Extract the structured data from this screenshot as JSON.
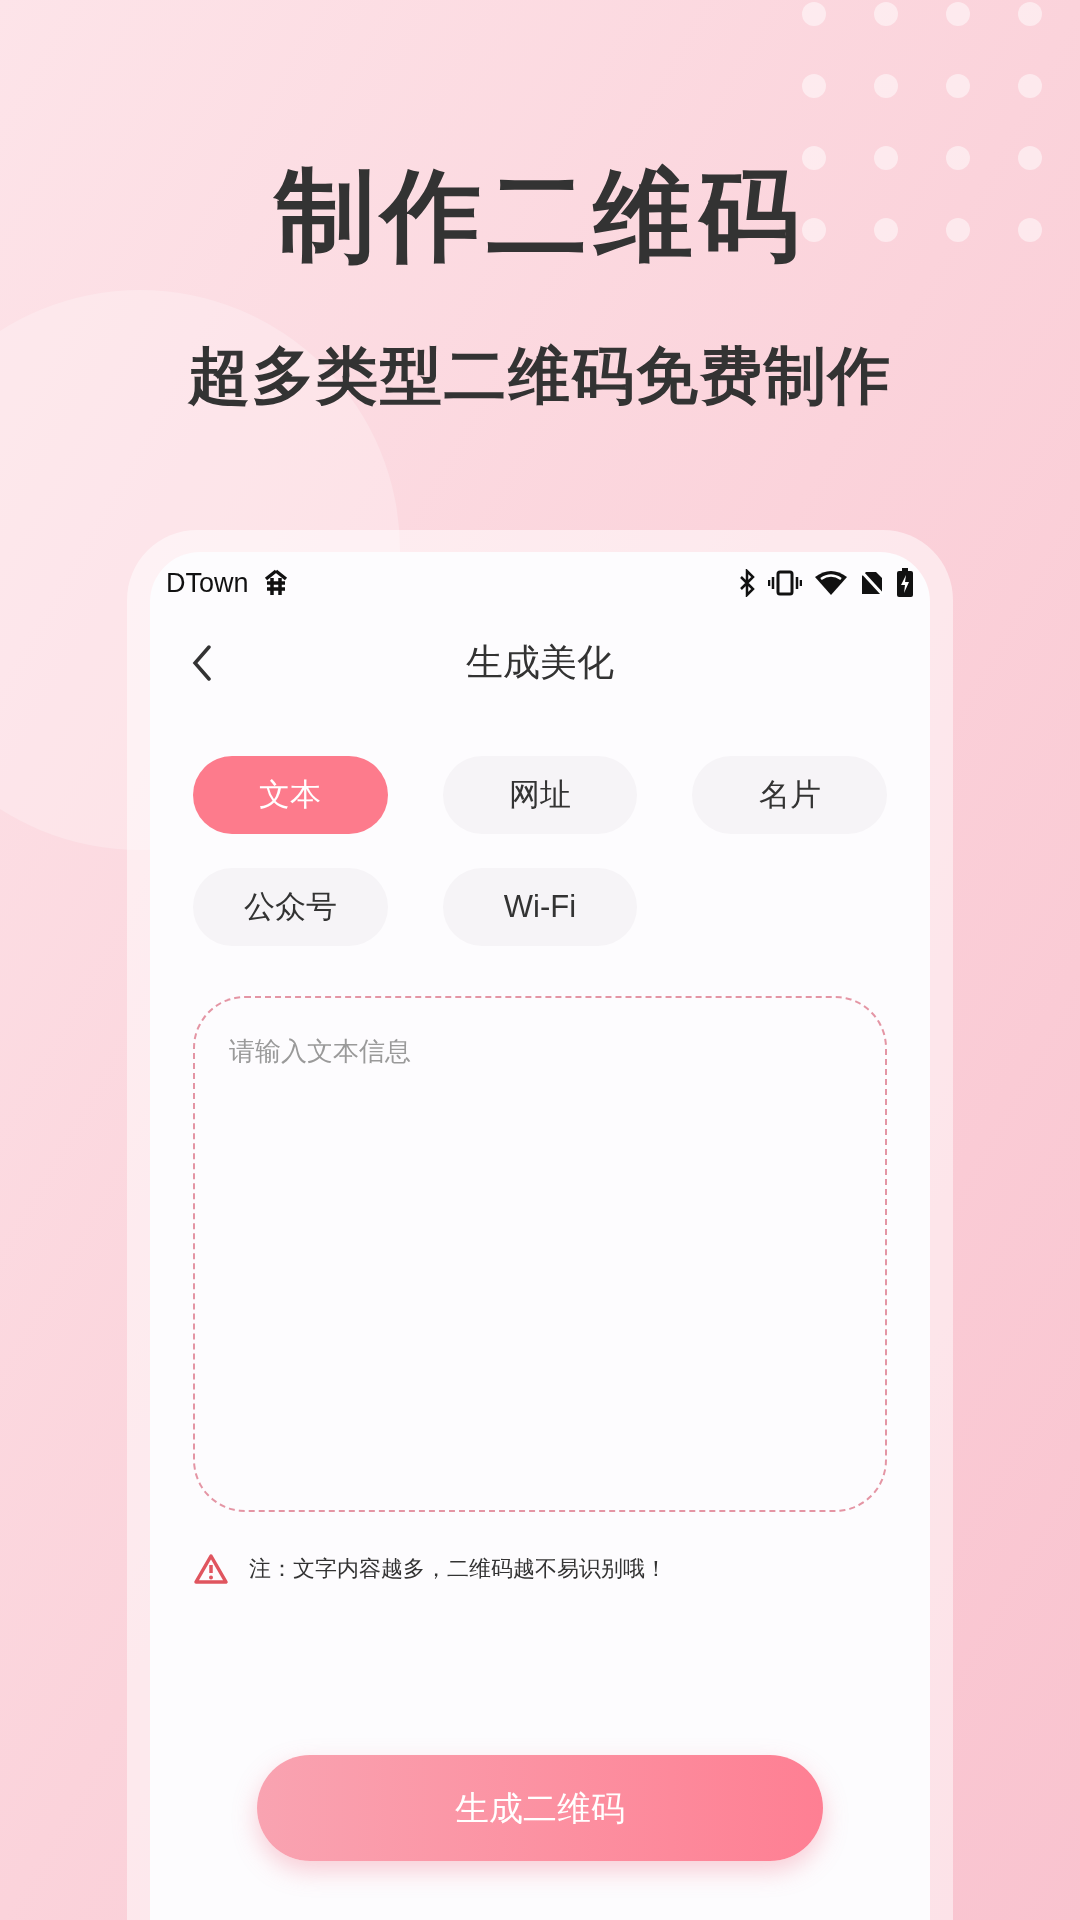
{
  "headline": "制作二维码",
  "subheadline": "超多类型二维码免费制作",
  "status_bar": {
    "carrier": "DTown"
  },
  "header": {
    "title": "生成美化"
  },
  "types": [
    {
      "label": "文本",
      "selected": true
    },
    {
      "label": "网址",
      "selected": false
    },
    {
      "label": "名片",
      "selected": false
    },
    {
      "label": "公众号",
      "selected": false
    },
    {
      "label": "Wi-Fi",
      "selected": false
    }
  ],
  "text_input": {
    "placeholder": "请输入文本信息"
  },
  "note": "注：文字内容越多，二维码越不易识别哦！",
  "submit_button": "生成二维码"
}
